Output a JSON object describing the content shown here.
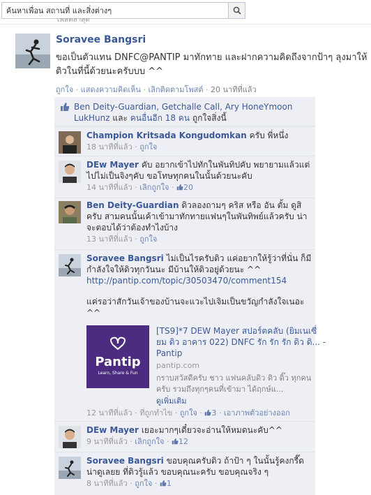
{
  "search": {
    "placeholder": "ค้นหาเพื่อน สถานที่ และสิ่งต่างๆ"
  },
  "section_label": "โพสต์ล่าสุด",
  "post": {
    "author": "Soravee Bangsri",
    "text": "ขอเป็นตัวแทน DNFC@PANTIP มาทักทาย และฝากความคิดถึงจากป้าๆ ลุงมาให้ติวในที่นี้ด้วยนะครับบบ ^^",
    "actions": {
      "like": "ถูกใจ",
      "comment": "แสดงความคิดเห็น",
      "unfollow": "เลิกติดตามโพสต์",
      "time": "20 นาทีที่แล้ว"
    }
  },
  "likes": {
    "names": "Ben Deity-Guardian, Getchalle Call, Ary HoneYmoon LukHunz",
    "and": "และ",
    "others": "คนอื่นอีก 18 คน",
    "suffix": "ถูกใจสิ่งนี้"
  },
  "comments": [
    {
      "author": "Champion Kritsada Kongudomkan",
      "text": "ครับ พี่หนึ่ง",
      "time": "18 นาทีที่แล้ว",
      "action": "ถูกใจ",
      "likes": ""
    },
    {
      "author": "DEw Mayer",
      "text": "คับ อยากเข้าไปทักในพันทิปคับ พยายามแล้วแต่ไปไม่เป็นจิงๆคับ ขอโทษทุกคนในนั้นด้วยนะคับ",
      "time": "14 นาทีที่แล้ว",
      "action": "เลิกถูกใจ",
      "likes": "20"
    },
    {
      "author": "Ben Deity-Guardian",
      "text": "ดิวลองถามๆ คริส หรือ อัน ตั้ม ดูสิครับ สามคนนั้นเค้าเข้ามาทักทายแฟนๆในพันทิพย์แล้วครับ น่าจะตอบได้ว่าต้องทำไงบ้าง",
      "time": "13 นาทีที่แล้ว",
      "action": "ถูกใจ",
      "likes": ""
    },
    {
      "author": "Soravee Bangsri",
      "text": "ไม่เป็นไรครับดิว แค่อยากให้รู้ว่าที่นั่น ก็มีกำลังใจให้ดิวทุกวันนะ มีบ้านให้ดิวอยู่ด้วยนะ ^^",
      "url": "http://pantip.com/topic/30503470/comment154",
      "text2": "แค่รอว่าสักวันเจ้าของบ้านจะแวะไปเจิมเป็นขวัญกำลังใจเนอะ ^^",
      "share": {
        "logo_text": "Pantip",
        "logo_tagline": "Learn, Share & Fun",
        "title": "[TS9]*7 DEW Mayer สปอร์ตคลับ (ยิมเนเซี่ยม ดิว อาคาร 022) DNFC รัก รัก รัก ดิว ดิ... - Pantip",
        "domain": "pantip.com",
        "desc": "กราบสวัสดีครับ ชาว แฟนคลับดิว ดิว ดิ๊ว ทุกคนครับ รวมถึงทุกๆคนที่เข้ามา ได้ฤกษ์แ...",
        "more": "ดูเพิ่มเติม"
      },
      "time": "12 นาทีที่แล้ว",
      "place": "ที่ถูกทำไข",
      "action": "ถูกใจ",
      "likes": "3",
      "remove": "เอาภาพตัวอย่างออก"
    },
    {
      "author": "DEw Mayer",
      "text": "เยอะมากๆเดี๋ยวจะอ่านให้หมดนะคับ^^",
      "time": "9 นาทีที่แล้ว",
      "action": "เลิกถูกใจ",
      "likes": "12"
    },
    {
      "author": "Soravee Bangsri",
      "text": "ขอบคุณครับดิว ถ้าป้า ๆ ในนั้นรู้คงกรี๊ดน่าดูเลยย ที่ดิวรู้แล้ว ขอบคุณนะครับ ขอบคุณจริง ๆ",
      "time": "8 นาทีที่แล้ว",
      "action": "ถูกใจ",
      "likes": "1"
    }
  ],
  "colors": {
    "link": "#3b5998",
    "ufi_bg": "#edeff4",
    "meta": "#999999",
    "pantip_purple": "#4b2c80"
  }
}
